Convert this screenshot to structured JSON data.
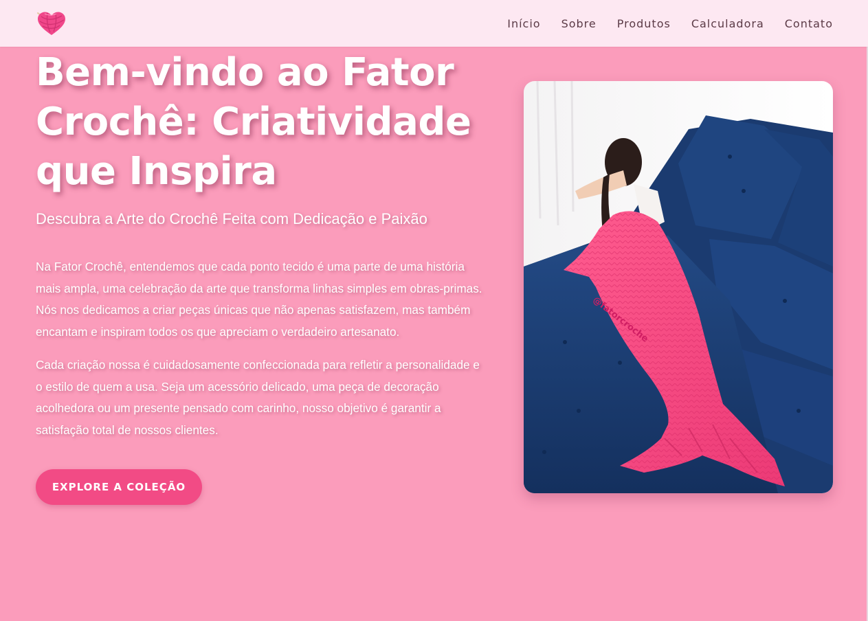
{
  "nav": {
    "logo_icon": "yarn-ball-heart-icon",
    "links": [
      "Início",
      "Sobre",
      "Produtos",
      "Calculadora",
      "Contato"
    ]
  },
  "hero": {
    "title": "Bem-vindo ao Fator Crochê: Criatividade que Inspira",
    "subtitle": "Descubra a Arte do Crochê Feita com Dedicação e Paixão",
    "paragraphs": [
      "Na Fator Crochê, entendemos que cada ponto tecido é uma parte de uma história mais ampla, uma celebração da arte que transforma linhas simples em obras-primas. Nós nos dedicamos a criar peças únicas que não apenas satisfazem, mas também encantam e inspiram todos os que apreciam o verdadeiro artesanato.",
      "Cada criação nossa é cuidadosamente confeccionada para refletir a personalidade e o estilo de quem a usa. Seja um acessório delicado, uma peça de decoração acolhedora ou um presente pensado com carinho, nosso objetivo é garantir a satisfação total de nossos clientes."
    ],
    "cta_label": "EXPLORE A COLEÇÃO",
    "image_watermark": "@fatorcroche"
  },
  "colors": {
    "background": "#fb9cbb",
    "navbar": "#fde8f2",
    "cta": "#f24b85",
    "sofa": "#1d3d73",
    "blanket": "#f7477e"
  }
}
